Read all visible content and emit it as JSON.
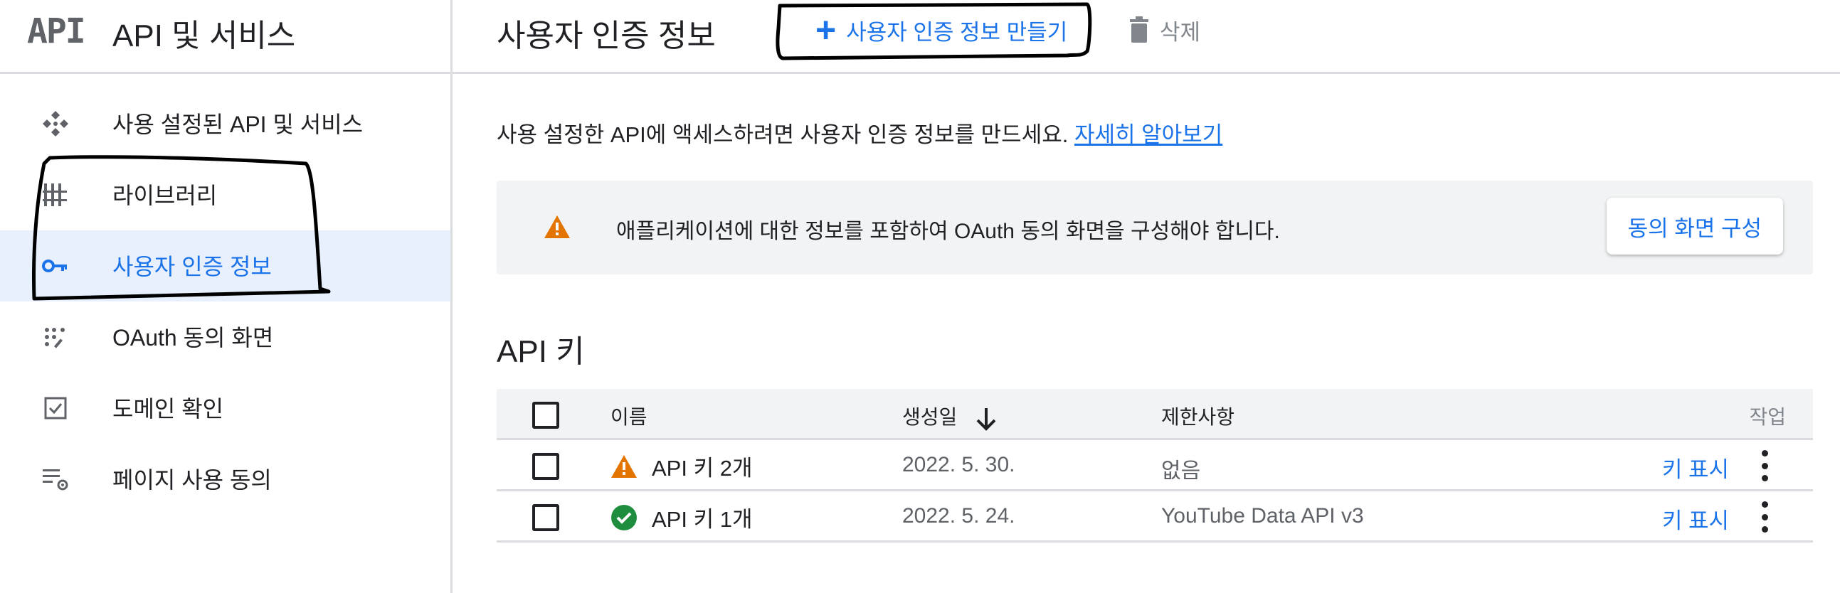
{
  "sidebar": {
    "logo": "API",
    "title": "API 및 서비스",
    "items": [
      {
        "label": "사용 설정된 API 및 서비스",
        "icon": "api-services-icon"
      },
      {
        "label": "라이브러리",
        "icon": "library-icon"
      },
      {
        "label": "사용자 인증 정보",
        "icon": "key-icon",
        "active": true
      },
      {
        "label": "OAuth 동의 화면",
        "icon": "oauth-consent-icon"
      },
      {
        "label": "도메인 확인",
        "icon": "checkbox-icon"
      },
      {
        "label": "페이지 사용 동의",
        "icon": "settings-list-icon"
      }
    ]
  },
  "topbar": {
    "title": "사용자 인증 정보",
    "create_label": "사용자 인증 정보 만들기",
    "delete_label": "삭제"
  },
  "main": {
    "intro_text": "사용 설정한 API에 액세스하려면 사용자 인증 정보를 만드세요.",
    "learn_more": "자세히 알아보기",
    "banner_text": "애플리케이션에 대한 정보를 포함하여 OAuth 동의 화면을 구성해야 합니다.",
    "banner_button": "동의 화면 구성",
    "section_title": "API 키"
  },
  "table": {
    "headers": {
      "name": "이름",
      "created": "생성일",
      "restrictions": "제한사항",
      "actions": "작업"
    },
    "rows": [
      {
        "name": "API 키 2개",
        "status": "warning",
        "created": "2022. 5. 30.",
        "restrictions": "없음",
        "action": "키 표시"
      },
      {
        "name": "API 키 1개",
        "status": "ok",
        "created": "2022. 5. 24.",
        "restrictions": "YouTube Data API v3",
        "action": "키 표시"
      }
    ]
  },
  "colors": {
    "accent": "#1a73e8",
    "warning": "#e37400",
    "success": "#1e8e3e",
    "active_bg": "#e8f0fe"
  }
}
